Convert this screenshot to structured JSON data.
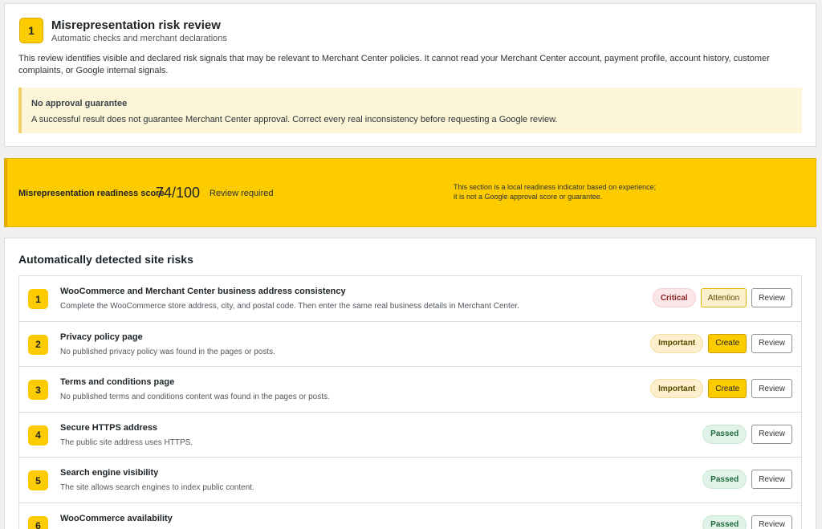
{
  "intro": {
    "number": "1",
    "title": "Misrepresentation risk review",
    "subtitle": "Automatic checks and merchant declarations",
    "description": "This review identifies visible and declared risk signals that may be relevant to Merchant Center policies. It cannot read your Merchant Center account, payment profile, account history, customer complaints, or Google internal signals.",
    "notice": {
      "title": "No approval guarantee",
      "text": "A successful result does not guarantee Merchant Center approval. Correct every real inconsistency before requesting a Google review."
    }
  },
  "score": {
    "label": "Misrepresentation readiness score",
    "value": "74/100",
    "status": "Review required",
    "note_line1": "This section is a local readiness indicator based on experience;",
    "note_line2": "it is not a Google approval score or guarantee."
  },
  "risks": {
    "title": "Automatically detected site risks",
    "items": [
      {
        "number": "1",
        "title": "WooCommerce and Merchant Center business address consistency",
        "description": "Complete the WooCommerce store address, city, and postal code. Then enter the same real business details in Merchant Center.",
        "severity": "Critical",
        "severity_class": "critical",
        "action": "Attention",
        "action_class": "attention",
        "review": "Review"
      },
      {
        "number": "2",
        "title": "Privacy policy page",
        "description": "No published privacy policy was found in the pages or posts.",
        "severity": "Important",
        "severity_class": "important",
        "action": "Create",
        "action_class": "create",
        "review": "Review"
      },
      {
        "number": "3",
        "title": "Terms and conditions page",
        "description": "No published terms and conditions content was found in the pages or posts.",
        "severity": "Important",
        "severity_class": "important",
        "action": "Create",
        "action_class": "create",
        "review": "Review"
      },
      {
        "number": "4",
        "title": "Secure HTTPS address",
        "description": "The public site address uses HTTPS.",
        "severity": "Passed",
        "severity_class": "passed",
        "action": "",
        "action_class": "",
        "review": "Review"
      },
      {
        "number": "5",
        "title": "Search engine visibility",
        "description": "The site allows search engines to index public content.",
        "severity": "Passed",
        "severity_class": "passed",
        "action": "",
        "action_class": "",
        "review": "Review"
      },
      {
        "number": "6",
        "title": "WooCommerce availability",
        "description": "",
        "severity": "Passed",
        "severity_class": "passed",
        "action": "",
        "action_class": "",
        "review": "Review"
      }
    ]
  },
  "colors": {
    "accent_yellow": "#fccb00",
    "critical_bg": "#fbe7e8",
    "passed_bg": "#e1f3e8",
    "notice_bg": "#fcf5d8"
  }
}
